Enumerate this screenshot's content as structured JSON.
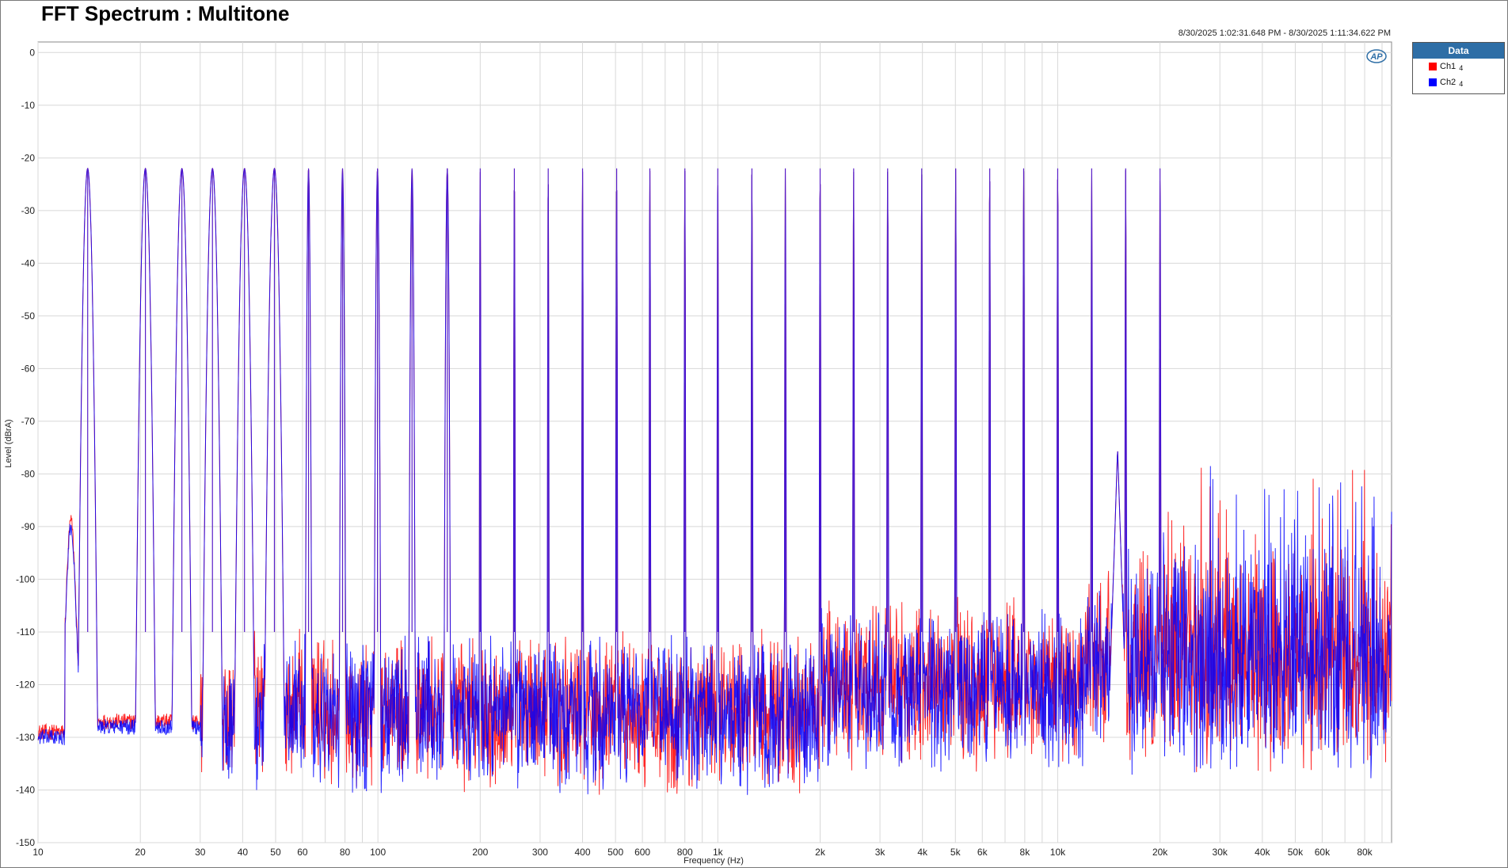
{
  "title": "FFT Spectrum : Multitone",
  "timestamp": "8/30/2025 1:02:31.648 PM - 8/30/2025 1:11:34.622 PM",
  "legend": {
    "header": "Data",
    "items": [
      {
        "label": "Ch1",
        "index": "4",
        "color": "#ff0000"
      },
      {
        "label": "Ch2",
        "index": "4",
        "color": "#0000ff"
      }
    ]
  },
  "chart_data": {
    "type": "line",
    "title": "FFT Spectrum : Multitone",
    "xlabel": "Frequency (Hz)",
    "ylabel": "Level (dBrA)",
    "xscale": "log",
    "xlim": [
      10,
      96000
    ],
    "ylim": [
      -150,
      2
    ],
    "grid": true,
    "legend_position": "right-outside-top",
    "x_ticks": [
      10,
      20,
      30,
      40,
      50,
      60,
      80,
      100,
      200,
      300,
      400,
      500,
      600,
      800,
      1000,
      2000,
      3000,
      4000,
      5000,
      6000,
      8000,
      10000,
      20000,
      30000,
      40000,
      50000,
      60000,
      80000
    ],
    "x_tick_labels": [
      "10",
      "20",
      "30",
      "40",
      "50",
      "60",
      "80",
      "100",
      "200",
      "300",
      "400",
      "500",
      "600",
      "800",
      "1k",
      "2k",
      "3k",
      "4k",
      "5k",
      "6k",
      "8k",
      "10k",
      "20k",
      "30k",
      "40k",
      "50k",
      "60k",
      "80k"
    ],
    "y_ticks": [
      0,
      -10,
      -20,
      -30,
      -40,
      -50,
      -60,
      -70,
      -80,
      -90,
      -100,
      -110,
      -120,
      -130,
      -140,
      -150
    ],
    "y_tick_labels": [
      "0",
      "-10",
      "-20",
      "-30",
      "-40",
      "-50",
      "-60",
      "-70",
      "-80",
      "-90",
      "-100",
      "-110",
      "-120",
      "-130",
      "-140",
      "-150"
    ],
    "tone_peaks_hz": [
      14,
      20.7,
      26.5,
      32.6,
      40.5,
      49.6,
      62.5,
      78.7,
      99.7,
      126,
      160,
      200,
      252,
      317,
      400,
      504,
      631,
      800,
      1000,
      1260,
      1580,
      2000,
      2510,
      3160,
      3980,
      5010,
      6310,
      7940,
      10000,
      12590,
      15850,
      20000
    ],
    "tone_level_db": -22,
    "series": [
      {
        "name": "Ch1",
        "color": "#ff0000",
        "noise_floor_db": -135,
        "floor_ripple_db": [
          -140,
          -108
        ]
      },
      {
        "name": "Ch2",
        "color": "#0000ff",
        "noise_floor_db": -136,
        "floor_ripple_db": [
          -141,
          -109
        ]
      }
    ],
    "annotations": {
      "low_freq_bump_db": -88,
      "hf_spurs_db": [
        -75,
        -77,
        -80,
        -85
      ]
    }
  }
}
